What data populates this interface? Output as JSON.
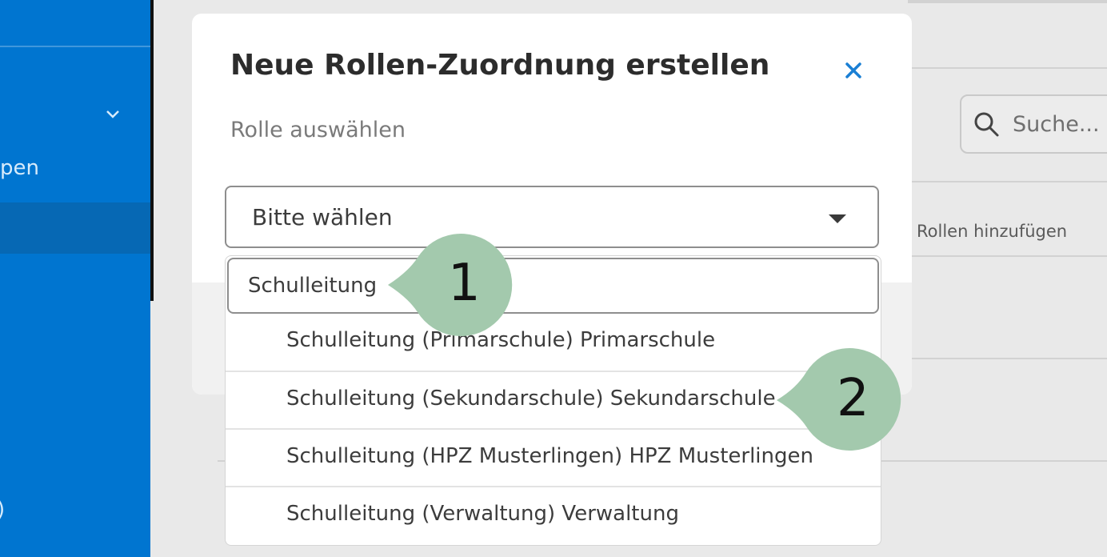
{
  "sidebar": {
    "item_partial": "pen",
    "bottom_partial": ")"
  },
  "background": {
    "search_placeholder": "Suche...",
    "add_roles_label": "Rollen hinzufügen"
  },
  "modal": {
    "title": "Neue Rollen-Zuordnung erstellen",
    "subtitle": "Rolle auswählen",
    "select_value": "Bitte wählen",
    "filter_value": "Schulleitung",
    "options": [
      "Schulleitung (Primarschule) Primarschule",
      "Schulleitung (Sekundarschule) Sekundarschule",
      "Schulleitung (HPZ Musterlingen) HPZ Musterlingen",
      "Schulleitung (Verwaltung) Verwaltung"
    ]
  },
  "callouts": [
    "1",
    "2"
  ],
  "colors": {
    "sidebar": "#0075d0",
    "accent": "#1a7fd4",
    "callout": "#a3c9ad"
  }
}
